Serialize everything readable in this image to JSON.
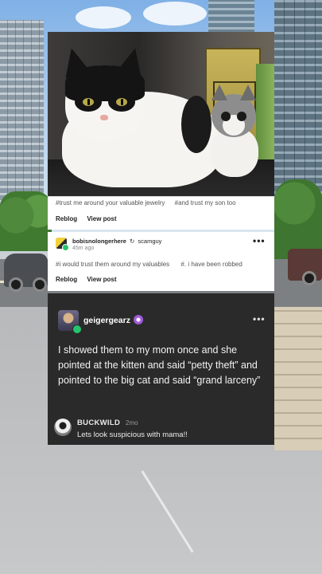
{
  "photo_post": {
    "tags": [
      "#trust me around your valuable jewelry",
      "#and trust my son too"
    ],
    "actions": {
      "reblog": "Reblog",
      "view_post": "View post"
    }
  },
  "reblog_post": {
    "user": "bobisnolongerhere",
    "reblog_icon": "↻",
    "reblogged_from": "scamguy",
    "time": "45m ago",
    "menu": "•••",
    "tags": [
      "#i would trust them around my valuables",
      "#. i have been robbed"
    ],
    "actions": {
      "reblog": "Reblog",
      "view_post": "View post"
    }
  },
  "comment_post": {
    "user": "geigergearz",
    "menu": "•••",
    "text": "I showed them to my mom once and she pointed at the kitten and said “petty theft” and pointed to the big cat and said “grand larceny”",
    "reply": {
      "user": "BUCKWILD",
      "time": "2mo",
      "text": "Lets look suspicious with mama!!"
    }
  },
  "icons": [
    "more-icon",
    "reblog-icon",
    "verified-badge-icon",
    "online-status-icon"
  ],
  "colors": {
    "dark_card": "#2a2a2a",
    "online_green": "#24c46b",
    "badge_purple": "#a05ad8"
  }
}
